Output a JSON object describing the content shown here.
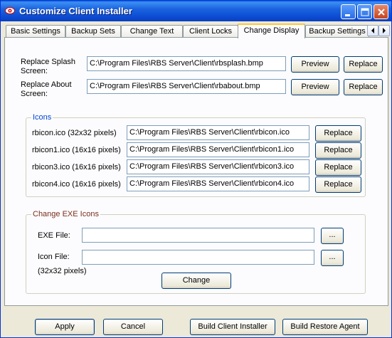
{
  "window": {
    "title": "Customize Client Installer"
  },
  "tabs": [
    {
      "label": "Basic Settings"
    },
    {
      "label": "Backup Sets"
    },
    {
      "label": "Change Text"
    },
    {
      "label": "Client Locks"
    },
    {
      "label": "Change Display"
    },
    {
      "label": "Backup Settings"
    }
  ],
  "active_tab": "Change Display",
  "splash": {
    "label": "Replace Splash Screen:",
    "value": "C:\\Program Files\\RBS Server\\Client\\rbsplash.bmp",
    "preview_label": "Preview",
    "replace_label": "Replace"
  },
  "about": {
    "label": "Replace About Screen:",
    "value": "C:\\Program Files\\RBS Server\\Client\\rbabout.bmp",
    "preview_label": "Preview",
    "replace_label": "Replace"
  },
  "icons_group": {
    "title": "Icons",
    "items": [
      {
        "label": "rbicon.ico (32x32 pixels)",
        "value": "C:\\Program Files\\RBS Server\\Client\\rbicon.ico",
        "button": "Replace"
      },
      {
        "label": "rbicon1.ico (16x16 pixels)",
        "value": "C:\\Program Files\\RBS Server\\Client\\rbicon1.ico",
        "button": "Replace"
      },
      {
        "label": "rbicon3.ico (16x16 pixels)",
        "value": "C:\\Program Files\\RBS Server\\Client\\rbicon3.ico",
        "button": "Replace"
      },
      {
        "label": "rbicon4.ico (16x16 pixels)",
        "value": "C:\\Program Files\\RBS Server\\Client\\rbicon4.ico",
        "button": "Replace"
      }
    ]
  },
  "exe_group": {
    "title": "Change EXE Icons",
    "exe_label": "EXE File:",
    "exe_value": "",
    "icon_label": "Icon File:",
    "icon_value": "",
    "icon_note": "(32x32 pixels)",
    "browse_label": "...",
    "change_label": "Change"
  },
  "footer": {
    "apply": "Apply",
    "cancel": "Cancel",
    "build_client": "Build Client Installer",
    "build_restore": "Build Restore Agent"
  }
}
